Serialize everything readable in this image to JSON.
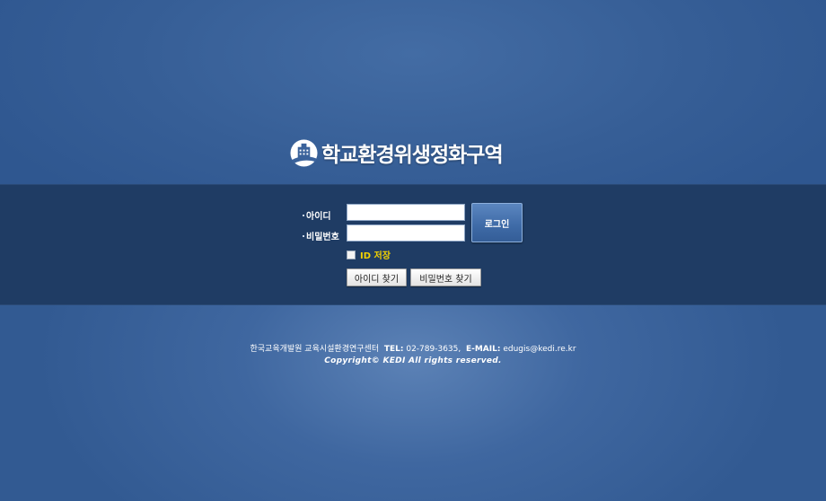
{
  "header": {
    "title": "학교환경위생정화구역",
    "logo_icon": "building-icon"
  },
  "login_form": {
    "id_label": "아이디",
    "id_value": "",
    "password_label": "비밀번호",
    "password_value": "",
    "login_button": "로그인",
    "save_id_label": "ID 저장",
    "save_id_checked": false,
    "find_id_button": "아이디 찾기",
    "find_password_button": "비밀번호 찾기"
  },
  "footer": {
    "org": "한국교육개발원 교육시설환경연구센터",
    "tel_label": "TEL:",
    "tel_value": "02-789-3635,",
    "email_label": "E-MAIL:",
    "email_value": "edugis@kedi.re.kr",
    "copyright": "Copyright© KEDI All rights reserved."
  },
  "colors": {
    "background": "#3f67a0",
    "band": "#1f3c64",
    "accent_yellow": "#f3d200"
  }
}
